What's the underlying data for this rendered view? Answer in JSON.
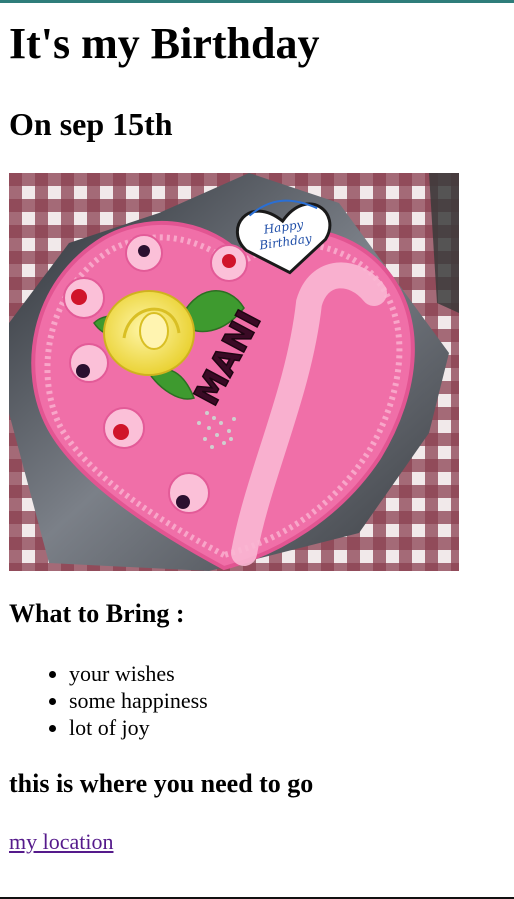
{
  "page": {
    "title": "It's my Birthday",
    "date_heading": "On sep 15th",
    "bring_heading": "What to Bring :",
    "bring_items": [
      "your wishes",
      "some happiness",
      "lot of joy"
    ],
    "location_heading": "this is where you need to go",
    "location_link": "my location"
  },
  "image": {
    "cake_text": "MANI",
    "topper_line1": "Happy",
    "topper_line2": "Birthday"
  },
  "colors": {
    "link": "#551a8b",
    "cake_pink": "#f07ab0",
    "tablecloth": "#7a2a3a",
    "rose_yellow": "#f3e44a",
    "leaf_green": "#3e9a2f"
  }
}
